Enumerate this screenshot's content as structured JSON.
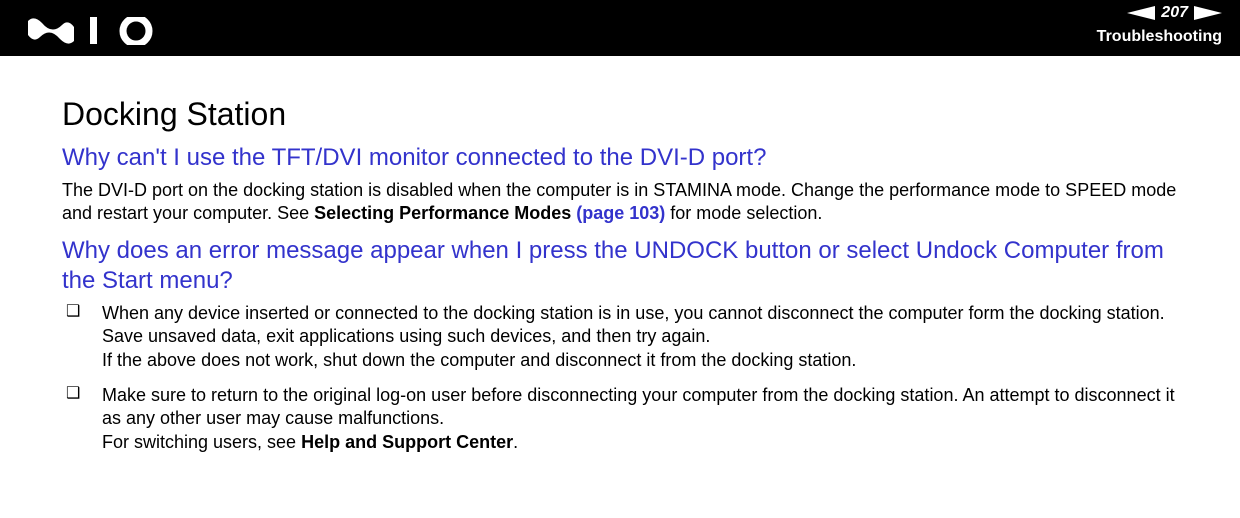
{
  "header": {
    "page_number": "207",
    "section": "Troubleshooting"
  },
  "content": {
    "title": "Docking Station",
    "q1": "Why can't I use the TFT/DVI monitor connected to the DVI-D port?",
    "a1_pre": "The DVI-D port on the docking station is disabled when the computer is in STAMINA mode. Change the performance mode to SPEED mode and restart your computer. See ",
    "a1_bold": "Selecting Performance Modes ",
    "a1_link": "(page 103)",
    "a1_post": " for mode selection.",
    "q2": "Why does an error message appear when I press the UNDOCK button or select Undock Computer from the Start menu?",
    "b1": "When any device inserted or connected to the docking station is in use, you cannot disconnect the computer form the docking station. Save unsaved data, exit applications using such devices, and then try again.\nIf the above does not work, shut down the computer and disconnect it from the docking station.",
    "b2_pre": "Make sure to return to the original log-on user before disconnecting your computer from the docking station. An attempt to disconnect it as any other user may cause malfunctions.\nFor switching users, see ",
    "b2_bold": "Help and Support Center",
    "b2_post": "."
  }
}
